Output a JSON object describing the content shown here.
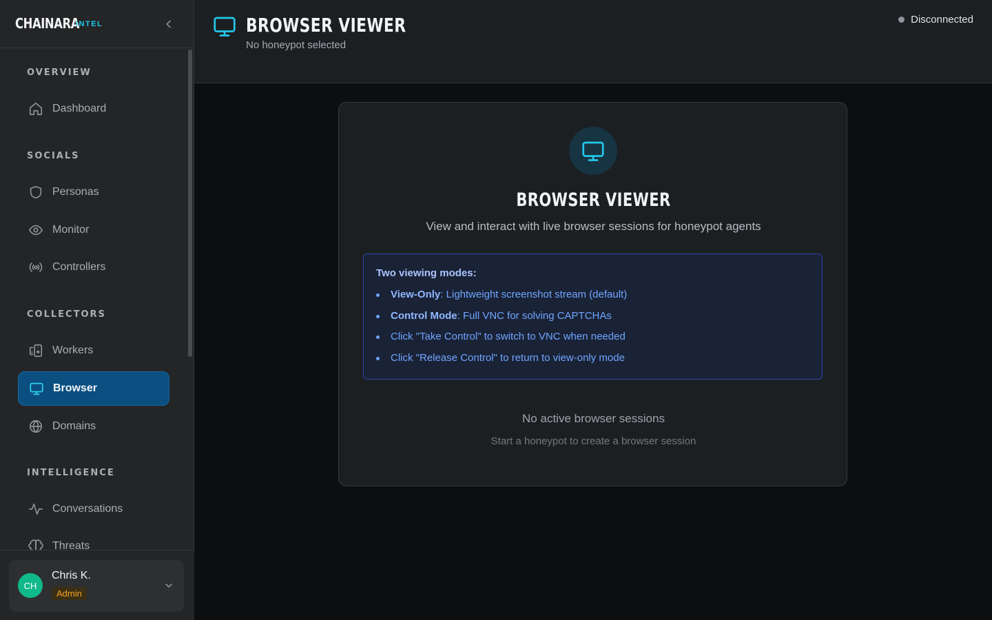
{
  "brand": {
    "name": "CHAINARA",
    "tag": "INTEL"
  },
  "sidebar": {
    "sections": [
      {
        "label": "OVERVIEW",
        "items": [
          {
            "label": "Dashboard",
            "icon": "home-icon"
          }
        ]
      },
      {
        "label": "SOCIALS",
        "items": [
          {
            "label": "Personas",
            "icon": "shield-icon"
          },
          {
            "label": "Monitor",
            "icon": "eye-icon"
          },
          {
            "label": "Controllers",
            "icon": "radio-icon"
          }
        ]
      },
      {
        "label": "COLLECTORS",
        "items": [
          {
            "label": "Workers",
            "icon": "devices-icon"
          },
          {
            "label": "Browser",
            "icon": "monitor-icon",
            "active": true
          },
          {
            "label": "Domains",
            "icon": "globe-icon"
          }
        ]
      },
      {
        "label": "INTELLIGENCE",
        "items": [
          {
            "label": "Conversations",
            "icon": "activity-icon"
          },
          {
            "label": "Threats",
            "icon": "brain-icon"
          }
        ]
      }
    ]
  },
  "user": {
    "initials": "CH",
    "name": "Chris K.",
    "role": "Admin"
  },
  "header": {
    "title": "BROWSER VIEWER",
    "subtitle": "No honeypot selected",
    "status": "Disconnected"
  },
  "card": {
    "title": "BROWSER VIEWER",
    "description": "View and interact with live browser sessions for honeypot agents",
    "modes_title": "Two viewing modes:",
    "modes": [
      {
        "strong": "View-Only",
        "text": ": Lightweight screenshot stream (default)"
      },
      {
        "strong": "Control Mode",
        "text": ": Full VNC for solving CAPTCHAs"
      },
      {
        "strong": "",
        "text": "Click \"Take Control\" to switch to VNC when needed"
      },
      {
        "strong": "",
        "text": "Click \"Release Control\" to return to view-only mode"
      }
    ],
    "empty_title": "No active browser sessions",
    "empty_subtitle": "Start a honeypot to create a browser session"
  },
  "colors": {
    "accent": "#1ec8e8",
    "active_nav": "#0b4f80",
    "info_border": "#2c45a8",
    "role_badge": "#f5a623",
    "avatar": "#10b98a"
  }
}
